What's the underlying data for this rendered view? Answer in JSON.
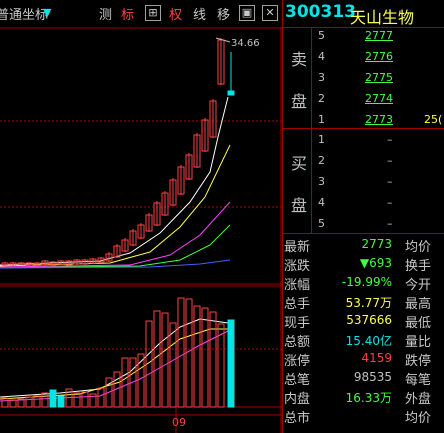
{
  "toolbar": {
    "coord_label": "普通坐标",
    "coord_dropdown": "▼",
    "btn_ce": "测",
    "btn_biao": "标",
    "btn_plus": "⊞",
    "btn_quan": "权",
    "btn_xian": "线",
    "btn_yi": "移",
    "btn_box": "▣",
    "btn_close": "✕"
  },
  "chart": {
    "high_label": "34.66",
    "date_label": "09"
  },
  "quote": {
    "code": "300313",
    "name": "天山生物",
    "sell_label_1": "卖",
    "sell_label_2": "盘",
    "buy_label_1": "买",
    "buy_label_2": "盘",
    "sell_levels": [
      {
        "level": "5",
        "price": "2777"
      },
      {
        "level": "4",
        "price": "2776"
      },
      {
        "level": "3",
        "price": "2775"
      },
      {
        "level": "2",
        "price": "2774"
      },
      {
        "level": "1",
        "price": "2773",
        "volume": "25("
      }
    ],
    "buy_levels": [
      {
        "level": "1",
        "price": "–"
      },
      {
        "level": "2",
        "price": "–"
      },
      {
        "level": "3",
        "price": "–"
      },
      {
        "level": "4",
        "price": "–"
      },
      {
        "level": "5",
        "price": "–"
      }
    ],
    "stats": [
      {
        "label": "最新",
        "value": "2773",
        "value_color": "#40ff40",
        "label2": "均价"
      },
      {
        "label": "涨跌",
        "value": "▼693",
        "value_color": "#40ff40",
        "label2": "换手"
      },
      {
        "label": "涨幅",
        "value": "-19.99%",
        "value_color": "#40ff40",
        "label2": "今开"
      },
      {
        "label": "总手",
        "value": "53.77万",
        "value_color": "#ffff4a",
        "label2": "最高"
      },
      {
        "label": "现手",
        "value": "537666",
        "value_color": "#ffff4a",
        "label2": "最低"
      },
      {
        "label": "总额",
        "value": "15.40亿",
        "value_color": "#00e5e5",
        "label2": "量比"
      },
      {
        "label": "涨停",
        "value": "4159",
        "value_color": "#ff4040",
        "label2": "跌停"
      },
      {
        "label": "总笔",
        "value": "98535",
        "value_color": "#c0c0c0",
        "label2": "每笔"
      },
      {
        "label": "内盘",
        "value": "16.33万",
        "value_color": "#40ff40",
        "label2": "外盘"
      },
      {
        "label": "总市",
        "value": "",
        "value_color": "#c0c0c0",
        "label2": "均价"
      }
    ]
  },
  "colors": {
    "up": "#ff4040",
    "down": "#00e5e5",
    "ma5": "#ffffff",
    "ma10": "#ffff4a",
    "ma20": "#ff40ff",
    "ma30": "#40ff40",
    "ma60": "#4060ff"
  }
}
